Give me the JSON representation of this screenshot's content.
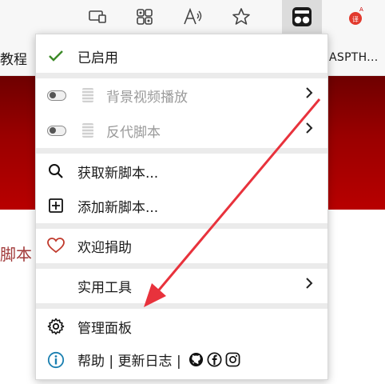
{
  "bookmarks": {
    "left_text": "教程",
    "right_text": "ASPTH..."
  },
  "menu": {
    "enabled_label": "已启用",
    "bg_video_label": "背景视频播放",
    "proxy_script_label": "反代脚本",
    "get_scripts_label": "获取新脚本...",
    "add_script_label": "添加新脚本...",
    "donate_label": "欢迎捐助",
    "utilities_label": "实用工具",
    "dashboard_label": "管理面板",
    "help_label": "帮助",
    "changelog_label": "更新日志",
    "divider": "|"
  },
  "page": {
    "text": "脚本"
  },
  "colors": {
    "check": "#3c8a28",
    "heart": "#c0392b",
    "info": "#1a7fb0",
    "arrow": "#e8323c",
    "banner": "#9a0000"
  },
  "icons": [
    "reading-mode-icon",
    "extensions-grid-icon",
    "read-aloud-icon",
    "favorite-star-icon",
    "tampermonkey-icon",
    "translate-icon",
    "check-icon",
    "toggle-switch",
    "chevron-right-icon",
    "search-icon",
    "plus-box-icon",
    "heart-icon",
    "gear-icon",
    "info-icon",
    "github-icon",
    "facebook-icon",
    "instagram-icon"
  ]
}
